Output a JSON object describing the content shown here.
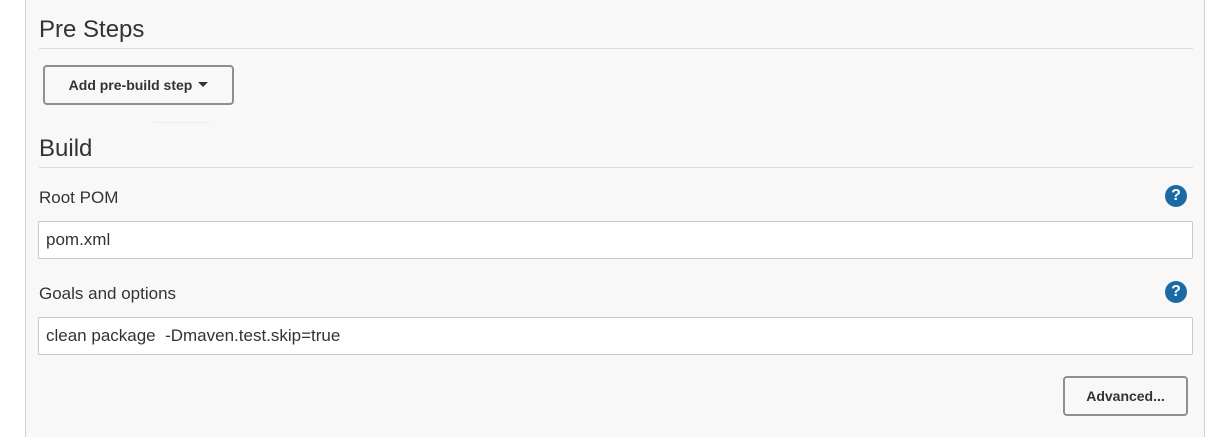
{
  "pre_steps": {
    "title": "Pre Steps",
    "add_step_button": "Add pre-build step"
  },
  "build": {
    "title": "Build",
    "root_pom": {
      "label": "Root POM",
      "value": "pom.xml",
      "help_symbol": "?"
    },
    "goals": {
      "label": "Goals and options",
      "value": "clean package  -Dmaven.test.skip=true",
      "help_symbol": "?"
    },
    "advanced_button": "Advanced..."
  },
  "colors": {
    "panel_background": "#f8f8f8",
    "help_icon": "#1b6aa5",
    "button_border": "#8c8f93"
  }
}
